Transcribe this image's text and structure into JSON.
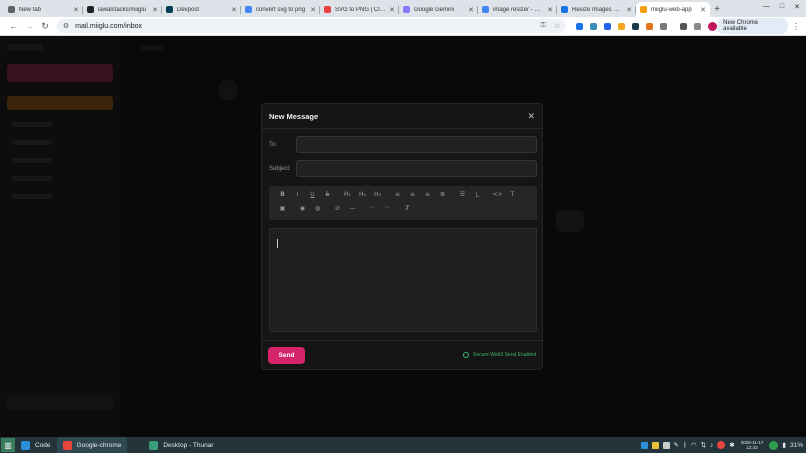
{
  "tabs": [
    {
      "title": "New tab",
      "icon": "chrome-icon",
      "color": "#5f6368"
    },
    {
      "title": "lawalstacks/miiglu",
      "icon": "github-icon",
      "color": "#222222"
    },
    {
      "title": "Devpost",
      "icon": "devpost-icon",
      "color": "#003e54"
    },
    {
      "title": "convert svg to png",
      "icon": "google-icon",
      "color": "#4285f4"
    },
    {
      "title": "SVG to PNG | Cloud",
      "icon": "cloudconvert-icon",
      "color": "#e8423f"
    },
    {
      "title": "Google Gemini",
      "icon": "gemini-icon",
      "color": "#8e75ff"
    },
    {
      "title": "image resizer - Goo",
      "icon": "google-icon",
      "color": "#4285f4"
    },
    {
      "title": "Resize Images Onli",
      "icon": "resize-icon",
      "color": "#1a73e8"
    },
    {
      "title": "miiglu-web-app",
      "icon": "miiglu-icon",
      "color": "#f59e0b",
      "active": true
    }
  ],
  "browser": {
    "url": "mail.miiglu.com/inbox",
    "new_chrome": "New Chrome available"
  },
  "modal": {
    "title": "New Message",
    "to_label": "To:",
    "to_value": "",
    "subject_label": "Subject:",
    "subject_value": "",
    "body_value": "",
    "send_label": "Send",
    "secure_text": "Secure Web3 Send Enabled"
  },
  "toolbar": {
    "row1": [
      {
        "name": "bold-button",
        "glyph": "B"
      },
      {
        "name": "italic-button",
        "glyph": "I"
      },
      {
        "name": "underline-button",
        "glyph": "U"
      },
      {
        "name": "strikethrough-button",
        "glyph": "S"
      },
      {
        "name": "heading1-button",
        "glyph": "H₁",
        "gap": true
      },
      {
        "name": "heading2-button",
        "glyph": "H₂"
      },
      {
        "name": "heading3-button",
        "glyph": "H₃"
      },
      {
        "name": "align-left-button",
        "glyph": "≡",
        "gap": true
      },
      {
        "name": "align-center-button",
        "glyph": "≡"
      },
      {
        "name": "align-right-button",
        "glyph": "≡"
      },
      {
        "name": "align-justify-button",
        "glyph": "≣"
      },
      {
        "name": "bullet-list-button",
        "glyph": "☰",
        "gap": true
      },
      {
        "name": "ordered-list-button",
        "glyph": "⒈"
      },
      {
        "name": "code-button",
        "glyph": "<>",
        "gap": true
      },
      {
        "name": "text-size-button",
        "glyph": "T"
      }
    ],
    "row2": [
      {
        "name": "image-button",
        "glyph": "▣"
      },
      {
        "name": "text-color-button",
        "glyph": "◉",
        "gap": true
      },
      {
        "name": "highlight-button",
        "glyph": "◍"
      },
      {
        "name": "link-button",
        "glyph": "⊘",
        "gap": true
      },
      {
        "name": "horizontal-rule-button",
        "glyph": "—"
      },
      {
        "name": "undo-button",
        "glyph": "↶",
        "gap": true,
        "dim": true
      },
      {
        "name": "redo-button",
        "glyph": "↷",
        "dim": true
      },
      {
        "name": "clear-format-button",
        "glyph": "T̸",
        "gap": true
      }
    ]
  },
  "taskbar": {
    "items": [
      {
        "label": "Code",
        "color": "#2d8fd5"
      },
      {
        "label": "Google-chrome",
        "color": "#e8453c",
        "active": true
      },
      {
        "label": "Desktop - Thunar",
        "color": "#3a9d7a"
      }
    ],
    "date": "2025-11-17",
    "time": "12:43",
    "battery": "31%"
  }
}
